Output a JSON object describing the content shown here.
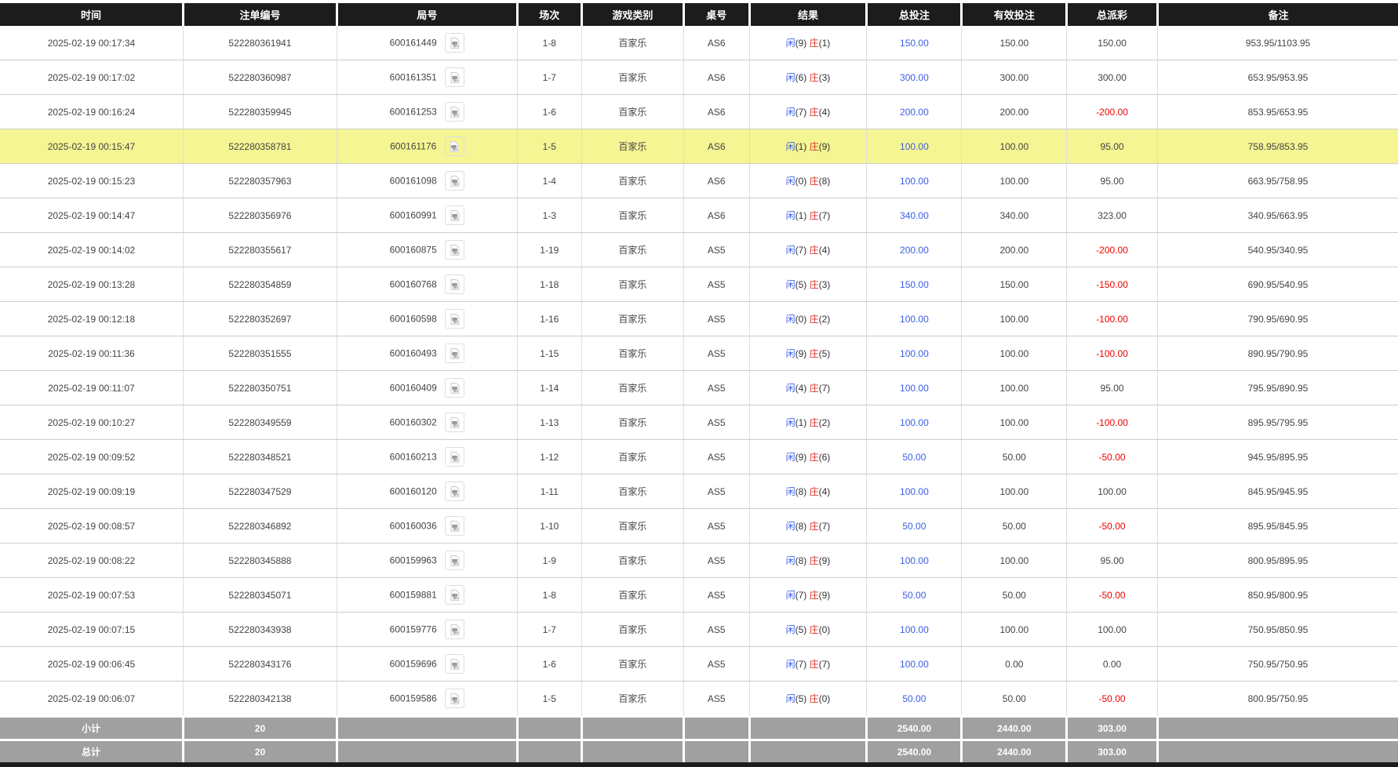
{
  "table": {
    "columns": [
      {
        "key": "time",
        "label": "时间"
      },
      {
        "key": "bet_id",
        "label": "注单编号"
      },
      {
        "key": "round",
        "label": "局号"
      },
      {
        "key": "session",
        "label": "场次"
      },
      {
        "key": "game",
        "label": "游戏类别"
      },
      {
        "key": "table_no",
        "label": "桌号"
      },
      {
        "key": "result",
        "label": "结果"
      },
      {
        "key": "total_bet",
        "label": "总投注"
      },
      {
        "key": "valid_bet",
        "label": "有效投注"
      },
      {
        "key": "payout",
        "label": "总派彩"
      },
      {
        "key": "remark",
        "label": "备注"
      }
    ],
    "result_labels": {
      "player": "闲",
      "banker": "庄"
    },
    "round_icon": "video-replay-icon",
    "rows": [
      {
        "time": "2025-02-19 00:17:34",
        "bet_id": "522280361941",
        "round": "600161449",
        "session": "1-8",
        "game": "百家乐",
        "table_no": "AS6",
        "player": "9",
        "banker": "1",
        "total_bet": "150.00",
        "valid_bet": "150.00",
        "payout": "150.00",
        "remark": "953.95/1103.95",
        "highlight": false
      },
      {
        "time": "2025-02-19 00:17:02",
        "bet_id": "522280360987",
        "round": "600161351",
        "session": "1-7",
        "game": "百家乐",
        "table_no": "AS6",
        "player": "6",
        "banker": "3",
        "total_bet": "300.00",
        "valid_bet": "300.00",
        "payout": "300.00",
        "remark": "653.95/953.95",
        "highlight": false
      },
      {
        "time": "2025-02-19 00:16:24",
        "bet_id": "522280359945",
        "round": "600161253",
        "session": "1-6",
        "game": "百家乐",
        "table_no": "AS6",
        "player": "7",
        "banker": "4",
        "total_bet": "200.00",
        "valid_bet": "200.00",
        "payout": "-200.00",
        "remark": "853.95/653.95",
        "highlight": false
      },
      {
        "time": "2025-02-19 00:15:47",
        "bet_id": "522280358781",
        "round": "600161176",
        "session": "1-5",
        "game": "百家乐",
        "table_no": "AS6",
        "player": "1",
        "banker": "9",
        "total_bet": "100.00",
        "valid_bet": "100.00",
        "payout": "95.00",
        "remark": "758.95/853.95",
        "highlight": true
      },
      {
        "time": "2025-02-19 00:15:23",
        "bet_id": "522280357963",
        "round": "600161098",
        "session": "1-4",
        "game": "百家乐",
        "table_no": "AS6",
        "player": "0",
        "banker": "8",
        "total_bet": "100.00",
        "valid_bet": "100.00",
        "payout": "95.00",
        "remark": "663.95/758.95",
        "highlight": false
      },
      {
        "time": "2025-02-19 00:14:47",
        "bet_id": "522280356976",
        "round": "600160991",
        "session": "1-3",
        "game": "百家乐",
        "table_no": "AS6",
        "player": "1",
        "banker": "7",
        "total_bet": "340.00",
        "valid_bet": "340.00",
        "payout": "323.00",
        "remark": "340.95/663.95",
        "highlight": false
      },
      {
        "time": "2025-02-19 00:14:02",
        "bet_id": "522280355617",
        "round": "600160875",
        "session": "1-19",
        "game": "百家乐",
        "table_no": "AS5",
        "player": "7",
        "banker": "4",
        "total_bet": "200.00",
        "valid_bet": "200.00",
        "payout": "-200.00",
        "remark": "540.95/340.95",
        "highlight": false
      },
      {
        "time": "2025-02-19 00:13:28",
        "bet_id": "522280354859",
        "round": "600160768",
        "session": "1-18",
        "game": "百家乐",
        "table_no": "AS5",
        "player": "5",
        "banker": "3",
        "total_bet": "150.00",
        "valid_bet": "150.00",
        "payout": "-150.00",
        "remark": "690.95/540.95",
        "highlight": false
      },
      {
        "time": "2025-02-19 00:12:18",
        "bet_id": "522280352697",
        "round": "600160598",
        "session": "1-16",
        "game": "百家乐",
        "table_no": "AS5",
        "player": "0",
        "banker": "2",
        "total_bet": "100.00",
        "valid_bet": "100.00",
        "payout": "-100.00",
        "remark": "790.95/690.95",
        "highlight": false
      },
      {
        "time": "2025-02-19 00:11:36",
        "bet_id": "522280351555",
        "round": "600160493",
        "session": "1-15",
        "game": "百家乐",
        "table_no": "AS5",
        "player": "9",
        "banker": "5",
        "total_bet": "100.00",
        "valid_bet": "100.00",
        "payout": "-100.00",
        "remark": "890.95/790.95",
        "highlight": false
      },
      {
        "time": "2025-02-19 00:11:07",
        "bet_id": "522280350751",
        "round": "600160409",
        "session": "1-14",
        "game": "百家乐",
        "table_no": "AS5",
        "player": "4",
        "banker": "7",
        "total_bet": "100.00",
        "valid_bet": "100.00",
        "payout": "95.00",
        "remark": "795.95/890.95",
        "highlight": false
      },
      {
        "time": "2025-02-19 00:10:27",
        "bet_id": "522280349559",
        "round": "600160302",
        "session": "1-13",
        "game": "百家乐",
        "table_no": "AS5",
        "player": "1",
        "banker": "2",
        "total_bet": "100.00",
        "valid_bet": "100.00",
        "payout": "-100.00",
        "remark": "895.95/795.95",
        "highlight": false
      },
      {
        "time": "2025-02-19 00:09:52",
        "bet_id": "522280348521",
        "round": "600160213",
        "session": "1-12",
        "game": "百家乐",
        "table_no": "AS5",
        "player": "9",
        "banker": "6",
        "total_bet": "50.00",
        "valid_bet": "50.00",
        "payout": "-50.00",
        "remark": "945.95/895.95",
        "highlight": false
      },
      {
        "time": "2025-02-19 00:09:19",
        "bet_id": "522280347529",
        "round": "600160120",
        "session": "1-11",
        "game": "百家乐",
        "table_no": "AS5",
        "player": "8",
        "banker": "4",
        "total_bet": "100.00",
        "valid_bet": "100.00",
        "payout": "100.00",
        "remark": "845.95/945.95",
        "highlight": false
      },
      {
        "time": "2025-02-19 00:08:57",
        "bet_id": "522280346892",
        "round": "600160036",
        "session": "1-10",
        "game": "百家乐",
        "table_no": "AS5",
        "player": "8",
        "banker": "7",
        "total_bet": "50.00",
        "valid_bet": "50.00",
        "payout": "-50.00",
        "remark": "895.95/845.95",
        "highlight": false
      },
      {
        "time": "2025-02-19 00:08:22",
        "bet_id": "522280345888",
        "round": "600159963",
        "session": "1-9",
        "game": "百家乐",
        "table_no": "AS5",
        "player": "8",
        "banker": "9",
        "total_bet": "100.00",
        "valid_bet": "100.00",
        "payout": "95.00",
        "remark": "800.95/895.95",
        "highlight": false
      },
      {
        "time": "2025-02-19 00:07:53",
        "bet_id": "522280345071",
        "round": "600159881",
        "session": "1-8",
        "game": "百家乐",
        "table_no": "AS5",
        "player": "7",
        "banker": "9",
        "total_bet": "50.00",
        "valid_bet": "50.00",
        "payout": "-50.00",
        "remark": "850.95/800.95",
        "highlight": false
      },
      {
        "time": "2025-02-19 00:07:15",
        "bet_id": "522280343938",
        "round": "600159776",
        "session": "1-7",
        "game": "百家乐",
        "table_no": "AS5",
        "player": "5",
        "banker": "0",
        "total_bet": "100.00",
        "valid_bet": "100.00",
        "payout": "100.00",
        "remark": "750.95/850.95",
        "highlight": false
      },
      {
        "time": "2025-02-19 00:06:45",
        "bet_id": "522280343176",
        "round": "600159696",
        "session": "1-6",
        "game": "百家乐",
        "table_no": "AS5",
        "player": "7",
        "banker": "7",
        "total_bet": "100.00",
        "valid_bet": "0.00",
        "payout": "0.00",
        "remark": "750.95/750.95",
        "highlight": false
      },
      {
        "time": "2025-02-19 00:06:07",
        "bet_id": "522280342138",
        "round": "600159586",
        "session": "1-5",
        "game": "百家乐",
        "table_no": "AS5",
        "player": "5",
        "banker": "0",
        "total_bet": "50.00",
        "valid_bet": "50.00",
        "payout": "-50.00",
        "remark": "800.95/750.95",
        "highlight": false
      }
    ],
    "footer": [
      {
        "label": "小计",
        "count": "20",
        "total_bet": "2540.00",
        "valid_bet": "2440.00",
        "payout": "303.00"
      },
      {
        "label": "总计",
        "count": "20",
        "total_bet": "2540.00",
        "valid_bet": "2440.00",
        "payout": "303.00"
      }
    ]
  },
  "colors": {
    "header_bg": "#1c1c1c",
    "footer_bg": "#a0a0a0",
    "highlight_row": "#f5f593",
    "player_blue": "#3a5fe5",
    "banker_red": "#d9342b",
    "amount_blue": "#3a5fe5",
    "negative_red": "#f20000"
  }
}
